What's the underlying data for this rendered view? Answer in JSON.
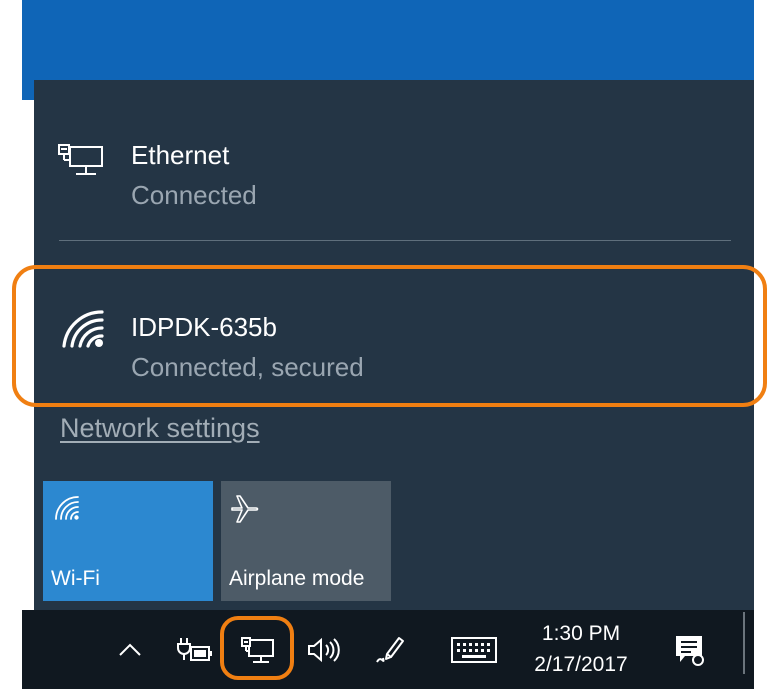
{
  "network_flyout": {
    "networks": [
      {
        "name": "Ethernet",
        "status": "Connected",
        "icon": "ethernet-monitor-icon"
      },
      {
        "name": "IDPDK-635b",
        "status": "Connected, secured",
        "icon": "wifi-icon"
      }
    ],
    "network_settings_link": "Network settings",
    "quick_actions": [
      {
        "label": "Wi-Fi",
        "icon": "wifi-icon",
        "state": "on"
      },
      {
        "label": "Airplane mode",
        "icon": "airplane-icon",
        "state": "off"
      }
    ]
  },
  "taskbar": {
    "time": "1:30 PM",
    "date": "2/17/2017",
    "tray_icons": [
      "chevron-up-icon",
      "battery-plugged-icon",
      "network-icon",
      "volume-icon",
      "pen-ink-icon",
      "keyboard-icon",
      "action-center-icon"
    ]
  },
  "colors": {
    "flyout_background": "#243545",
    "wifi_tile": "#2c88d0",
    "airplane_tile": "#4d5b67",
    "highlight": "#f07f12",
    "taskbar": "#101820",
    "desktop": "#0f65b7"
  }
}
